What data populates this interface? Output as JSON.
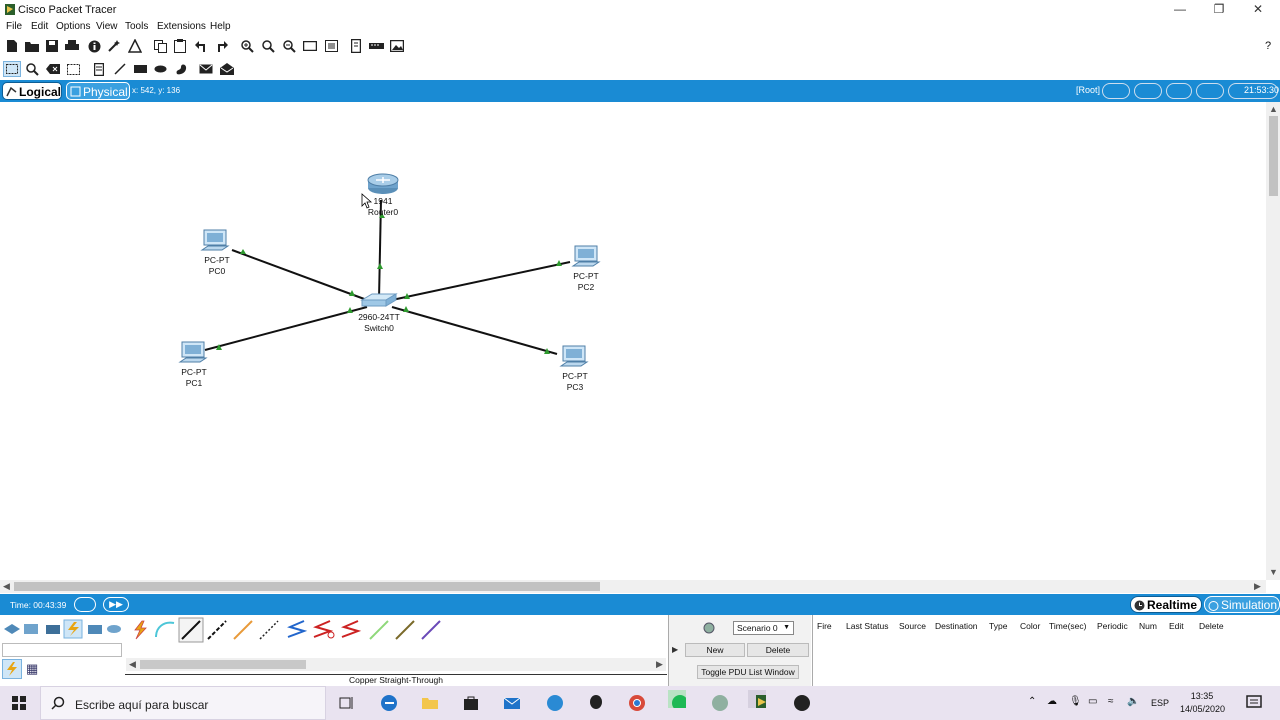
{
  "window": {
    "title": "Cisco Packet Tracer",
    "min": "—",
    "max": "❐",
    "close": "✕"
  },
  "menu": [
    "File",
    "Edit",
    "Options",
    "View",
    "Tools",
    "Extensions",
    "Help"
  ],
  "help_symbol": "?",
  "workspace_tabs": {
    "logical": "Logical",
    "physical": "Physical",
    "coords": "x: 542, y: 136",
    "root": "[Root]",
    "clock": "21:53:30"
  },
  "devices": [
    {
      "id": "router0",
      "model": "1941",
      "name": "Router0",
      "icon": "router-icon"
    },
    {
      "id": "switch0",
      "model": "2960-24TT",
      "name": "Switch0",
      "icon": "switch-icon"
    },
    {
      "id": "pc0",
      "model": "PC-PT",
      "name": "PC0",
      "icon": "pc-icon"
    },
    {
      "id": "pc1",
      "model": "PC-PT",
      "name": "PC1",
      "icon": "pc-icon"
    },
    {
      "id": "pc2",
      "model": "PC-PT",
      "name": "PC2",
      "icon": "pc-icon"
    },
    {
      "id": "pc3",
      "model": "PC-PT",
      "name": "PC3",
      "icon": "pc-icon"
    }
  ],
  "status": {
    "time": "Time: 00:43:39",
    "realtime": "Realtime",
    "simulation": "Simulation"
  },
  "connection_selected": "Copper Straight-Through",
  "pdu": {
    "scenario": "Scenario 0",
    "new": "New",
    "delete": "Delete",
    "toggle": "Toggle PDU List Window"
  },
  "pdu_columns": [
    "Fire",
    "Last Status",
    "Source",
    "Destination",
    "Type",
    "Color",
    "Time(sec)",
    "Periodic",
    "Num",
    "Edit",
    "Delete"
  ],
  "taskbar": {
    "search_placeholder": "Escribe aquí para buscar",
    "lang": "ESP",
    "time": "13:35",
    "date": "14/05/2020"
  },
  "colors": {
    "accent_blue": "#1a8bd4",
    "link_green": "#2e9a2e"
  }
}
